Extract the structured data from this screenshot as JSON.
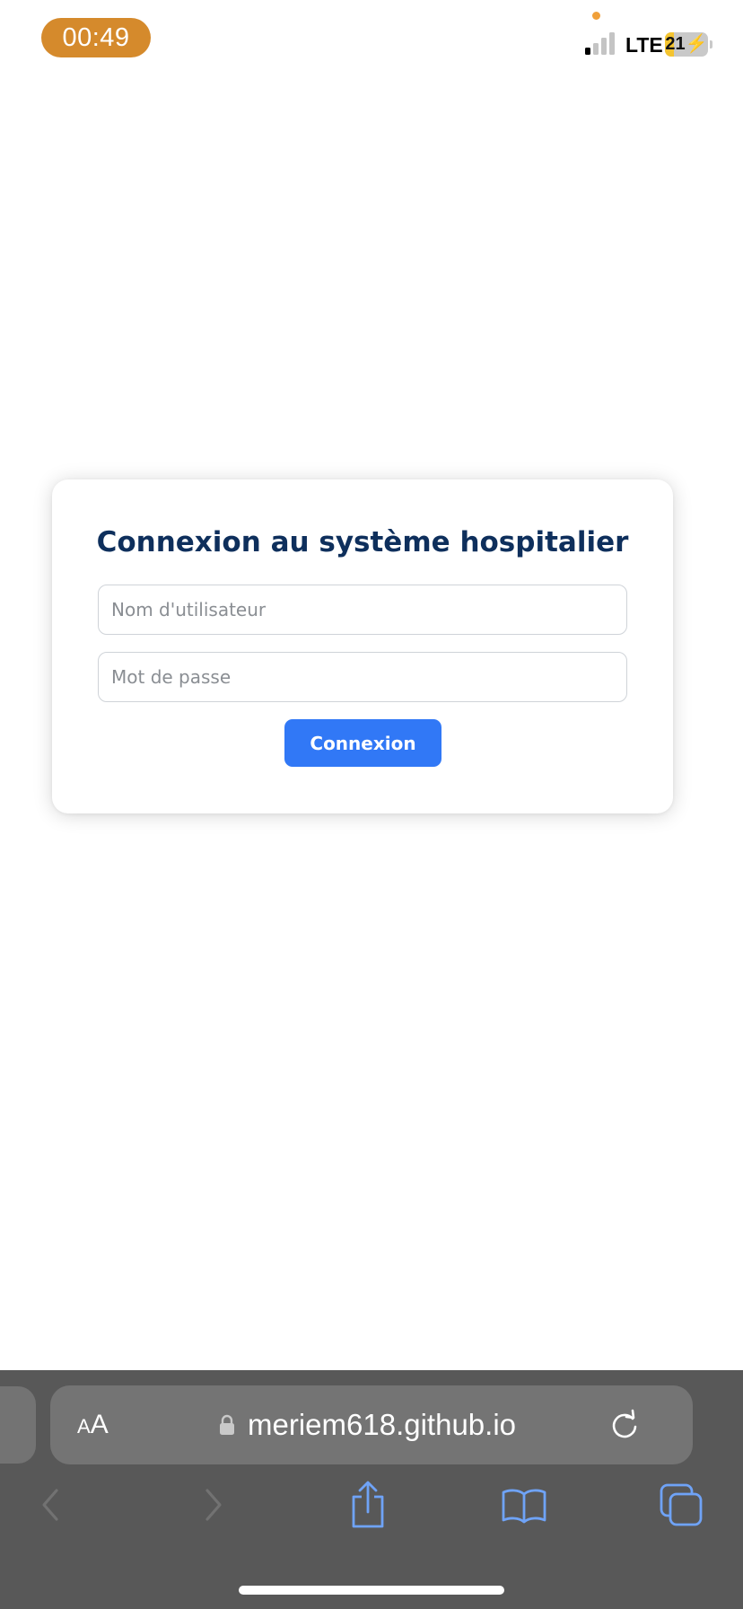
{
  "status_bar": {
    "time": "00:49",
    "network": "LTE",
    "battery_level": "21",
    "battery_percent": 21,
    "signal_bars_active": 1,
    "signal_bars_total": 4,
    "time_pill_color": "#d58a2c",
    "battery_color": "#f4c430",
    "icons": [
      "signal-bars-icon",
      "battery-charging-icon",
      "privacy-indicator-dot"
    ]
  },
  "login": {
    "title": "Connexion au système hospitalier",
    "username_placeholder": "Nom d'utilisateur",
    "username_value": "",
    "password_placeholder": "Mot de passe",
    "password_value": "",
    "submit_label": "Connexion",
    "title_color": "#0e2f5c",
    "button_color": "#3178f6"
  },
  "browser": {
    "text_size_small": "A",
    "text_size_large": "A",
    "url": "meriem618.github.io",
    "toolbar_color": "#585858",
    "accent_color": "#6fa3f7",
    "icons": [
      "lock-icon",
      "reload-icon",
      "back-arrow-icon",
      "forward-arrow-icon",
      "share-icon",
      "bookmarks-icon",
      "tabs-icon"
    ]
  }
}
